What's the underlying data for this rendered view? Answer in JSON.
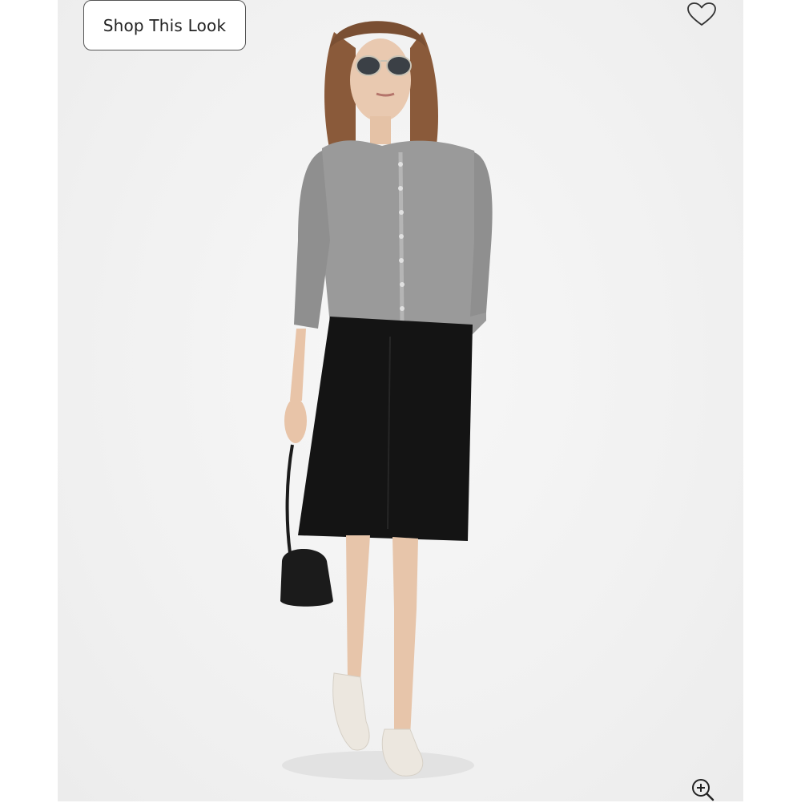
{
  "product_view": {
    "shop_look_label": "Shop This Look",
    "favorite_icon": "heart-outline-icon",
    "zoom_icon": "zoom-in-icon",
    "image": {
      "subject": "model-photo",
      "background_color": "#f1f1f1"
    }
  },
  "colors": {
    "button_border": "#555555",
    "icon_stroke": "#333333",
    "cardigan": "#9a9a9a",
    "skirt": "#141414",
    "shoes": "#ece7df",
    "hair": "#8a5a3a"
  }
}
